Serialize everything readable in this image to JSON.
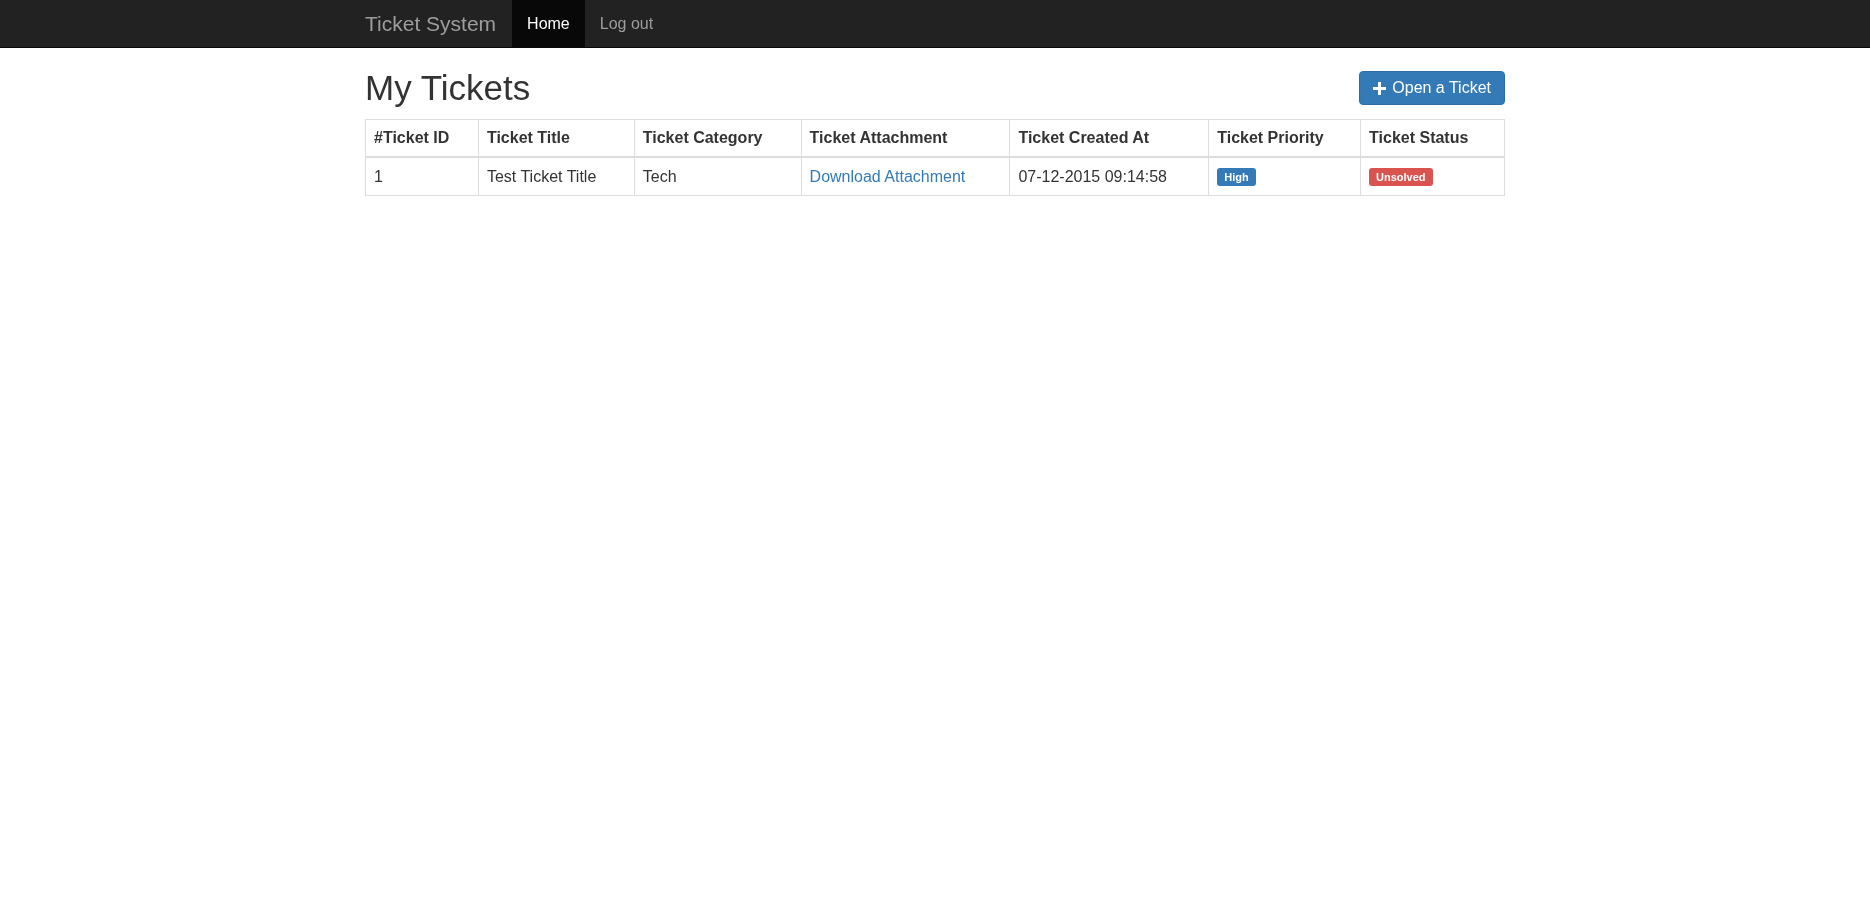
{
  "navbar": {
    "brand": "Ticket System",
    "items": [
      {
        "label": "Home",
        "selected": true
      },
      {
        "label": "Log out",
        "selected": false
      }
    ]
  },
  "page": {
    "title": "My Tickets",
    "action_button": "Open a Ticket"
  },
  "table": {
    "columns": [
      "#Ticket ID",
      "Ticket Title",
      "Ticket Category",
      "Ticket Attachment",
      "Ticket Created At",
      "Ticket Priority",
      "Ticket Status"
    ],
    "rows": [
      {
        "cells": [
          {
            "kind": "text",
            "text": "1"
          },
          {
            "kind": "text",
            "text": "Test Ticket Title"
          },
          {
            "kind": "text",
            "text": "Tech"
          },
          {
            "kind": "link",
            "text": "Download Attachment"
          },
          {
            "kind": "text",
            "text": "07-12-2015 09:14:58"
          },
          {
            "kind": "label",
            "text": "High",
            "color": "#337ab7"
          },
          {
            "kind": "label",
            "text": "Unsolved",
            "color": "#d9534f"
          }
        ]
      }
    ]
  }
}
